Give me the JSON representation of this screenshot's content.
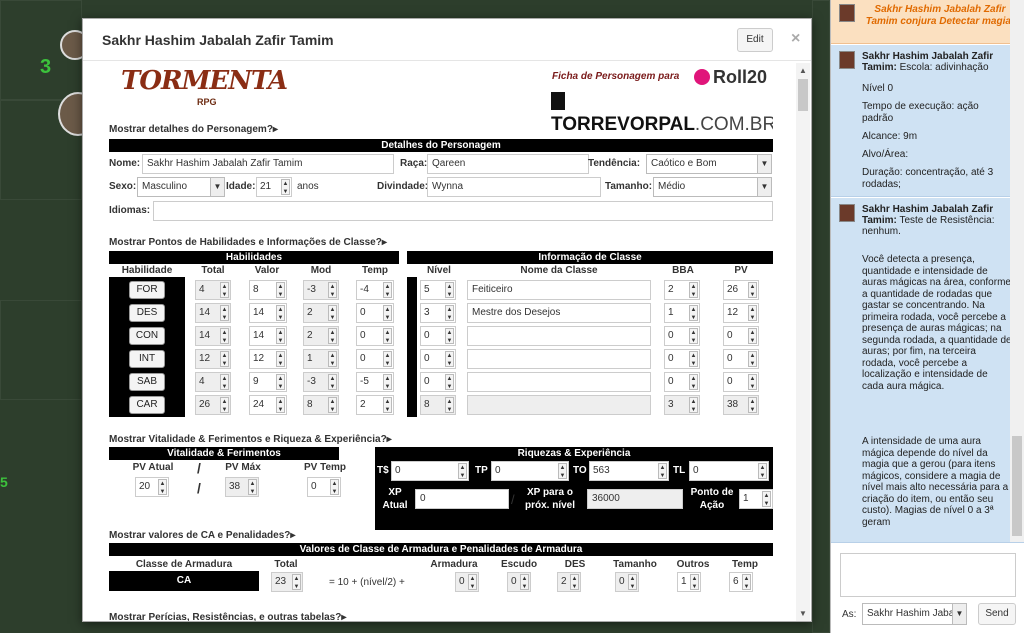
{
  "dialog": {
    "title": "Sakhr Hashim Jabalah Zafir Tamim",
    "edit_label": "Edit",
    "close_label": "×"
  },
  "header": {
    "logo_text": "TORMENTA",
    "logo_sub": "RPG",
    "ficha": "Ficha de Personagem para",
    "roll20": "Roll20",
    "torre": "TORREVORPAL",
    "torre_domain": ".COM.BR"
  },
  "details": {
    "toggle": "Mostrar detalhes do Personagem?▸",
    "bar": "Detalhes do Personagem",
    "nome_label": "Nome:",
    "nome": "Sakhr Hashim Jabalah Zafir Tamim",
    "raca_label": "Raça:",
    "raca": "Qareen",
    "tendencia_label": "Tendência:",
    "tendencia": "Caótico e Bom",
    "sexo_label": "Sexo:",
    "sexo": "Masculino",
    "idade_label": "Idade:",
    "idade": "21",
    "anos": "anos",
    "divindade_label": "Divindade:",
    "divindade": "Wynna",
    "tamanho_label": "Tamanho:",
    "tamanho": "Médio",
    "idiomas_label": "Idiomas:"
  },
  "abilities": {
    "toggle": "Mostrar Pontos de Habilidades e Informações de Classe?▸",
    "bar_hab": "Habilidades",
    "bar_class": "Informação de Classe",
    "headers": [
      "Habilidade",
      "Total",
      "Valor",
      "Mod",
      "Temp"
    ],
    "class_headers": [
      "Nível",
      "Nome da Classe",
      "BBA",
      "PV"
    ],
    "rows": [
      {
        "name": "FOR",
        "total": "4",
        "valor": "8",
        "mod": "-3",
        "temp": "-4",
        "nivel": "5",
        "classe": "Feiticeiro",
        "bba": "2",
        "pv": "26"
      },
      {
        "name": "DES",
        "total": "14",
        "valor": "14",
        "mod": "2",
        "temp": "0",
        "nivel": "3",
        "classe": "Mestre dos Desejos",
        "bba": "1",
        "pv": "12"
      },
      {
        "name": "CON",
        "total": "14",
        "valor": "14",
        "mod": "2",
        "temp": "0",
        "nivel": "0",
        "classe": "",
        "bba": "0",
        "pv": "0"
      },
      {
        "name": "INT",
        "total": "12",
        "valor": "12",
        "mod": "1",
        "temp": "0",
        "nivel": "0",
        "classe": "",
        "bba": "0",
        "pv": "0"
      },
      {
        "name": "SAB",
        "total": "4",
        "valor": "9",
        "mod": "-3",
        "temp": "-5",
        "nivel": "0",
        "classe": "",
        "bba": "0",
        "pv": "0"
      },
      {
        "name": "CAR",
        "total": "26",
        "valor": "24",
        "mod": "8",
        "temp": "2",
        "nivel": "8",
        "classe": "",
        "bba": "3",
        "pv": "38"
      }
    ]
  },
  "vitality": {
    "toggle": "Mostrar Vitalidade & Ferimentos e Riqueza & Experiência?▸",
    "bar_vit": "Vitalidade & Ferimentos",
    "bar_riq": "Riquezas & Experiência",
    "pv_atual_label": "PV Atual",
    "pv_atual": "20",
    "pv_max_label": "PV Máx",
    "pv_max": "38",
    "pv_temp_label": "PV Temp",
    "pv_temp": "0",
    "slash": "/",
    "ts_label": "T$",
    "ts": "0",
    "tp_label": "TP",
    "tp": "0",
    "to_label": "TO",
    "to": "563",
    "tl_label": "TL",
    "tl": "0",
    "xp_label": "XP Atual",
    "xp": "0",
    "xp_next_label": "XP para o próx. nível",
    "xp_next": "36000",
    "ponto_label": "Ponto de Ação",
    "ponto": "1"
  },
  "ca": {
    "toggle": "Mostrar valores de CA e Penalidades?▸",
    "bar": "Valores de Classe de Armadura e Penalidades de Armadura",
    "classe_label": "Classe de Armadura",
    "ca_label": "CA",
    "total_label": "Total",
    "total": "23",
    "formula": "= 10 + (nível/2) +",
    "armadura_label": "Armadura",
    "armadura": "0",
    "escudo_label": "Escudo",
    "escudo": "0",
    "des_label": "DES",
    "des": "2",
    "tamanho_label": "Tamanho",
    "tamanho": "0",
    "outros_label": "Outros",
    "outros": "1",
    "temp_label": "Temp",
    "temp": "6"
  },
  "more_toggle": "Mostrar Perícias, Resistências, e outras tabelas?▸",
  "chat": {
    "system": "Sakhr Hashim Jabalah Zafir Tamim conjura Detectar magia!",
    "m1_who": "Sakhr Hashim Jabalah Zafir Tamim:",
    "m1_first": "Escola: adivinhação",
    "m1_lines": [
      "Nível 0",
      "Tempo de execução: ação padrão",
      "Alcance: 9m",
      "Alvo/Área:",
      "Duração: concentração, até 3 rodadas;"
    ],
    "m2_who": "Sakhr Hashim Jabalah Zafir Tamim:",
    "m2_first": "Teste de Resistência: nenhum.",
    "m2_p1": "Você detecta a presença, quantidade e intensidade de auras mágicas na área, conforme a quantidade de rodadas que gastar se concentrando. Na primeira rodada, você percebe a presença de auras mágicas; na segunda rodada, a quantidade de auras; por fim, na terceira rodada, você percebe a localização e intensidade de cada aura mágica.",
    "m2_p2": "A intensidade de uma aura mágica depende do nível da magia que a gerou (para itens mágicos, considere a magia de nível mais alto necessária para a criação do item, ou então seu custo). Magias de nível 0 a 3ª geram",
    "as_label": "As:",
    "as_value": "Sakhr Hashim Jaba",
    "send_label": "Send"
  },
  "map": {
    "number": "3",
    "number2": "5"
  }
}
